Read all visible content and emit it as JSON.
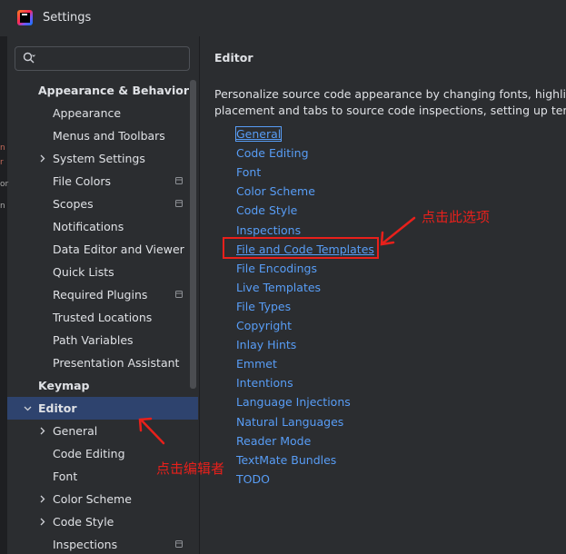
{
  "window": {
    "title": "Settings"
  },
  "search": {
    "placeholder": "",
    "value": ""
  },
  "sidebar": {
    "items": [
      {
        "label": "Appearance & Behavior",
        "level": 0,
        "group": true,
        "expanded": true
      },
      {
        "label": "Appearance",
        "level": 1
      },
      {
        "label": "Menus and Toolbars",
        "level": 1
      },
      {
        "label": "System Settings",
        "level": 1,
        "chevron": "right"
      },
      {
        "label": "File Colors",
        "level": 1,
        "project": true
      },
      {
        "label": "Scopes",
        "level": 1,
        "project": true
      },
      {
        "label": "Notifications",
        "level": 1
      },
      {
        "label": "Data Editor and Viewer",
        "level": 1
      },
      {
        "label": "Quick Lists",
        "level": 1
      },
      {
        "label": "Required Plugins",
        "level": 1,
        "project": true
      },
      {
        "label": "Trusted Locations",
        "level": 1
      },
      {
        "label": "Path Variables",
        "level": 1
      },
      {
        "label": "Presentation Assistant",
        "level": 1
      },
      {
        "label": "Keymap",
        "level": 0,
        "group": true
      },
      {
        "label": "Editor",
        "level": 0,
        "group": true,
        "chevron": "down",
        "selected": true
      },
      {
        "label": "General",
        "level": 1,
        "chevron": "right"
      },
      {
        "label": "Code Editing",
        "level": 1
      },
      {
        "label": "Font",
        "level": 1
      },
      {
        "label": "Color Scheme",
        "level": 1,
        "chevron": "right"
      },
      {
        "label": "Code Style",
        "level": 1,
        "chevron": "right"
      },
      {
        "label": "Inspections",
        "level": 1,
        "project": true
      }
    ]
  },
  "content": {
    "title": "Editor",
    "description_lines": [
      "Personalize source code appearance by changing fonts, highlightin",
      "placement and tabs to source code inspections, setting up templat"
    ],
    "links": [
      "General",
      "Code Editing",
      "Font",
      "Color Scheme",
      "Code Style",
      "Inspections",
      "File and Code Templates",
      "File Encodings",
      "Live Templates",
      "File Types",
      "Copyright",
      "Inlay Hints",
      "Emmet",
      "Intentions",
      "Language Injections",
      "Natural Languages",
      "Reader Mode",
      "TextMate Bundles",
      "TODO"
    ]
  },
  "annotations": {
    "click_option": "点击此选项",
    "click_editor": "点击编辑者"
  },
  "colors": {
    "background": "#2b2d30",
    "selection": "#2e436e",
    "link": "#589df6",
    "annotation_red": "#e8201b",
    "text": "#dfe1e5"
  }
}
